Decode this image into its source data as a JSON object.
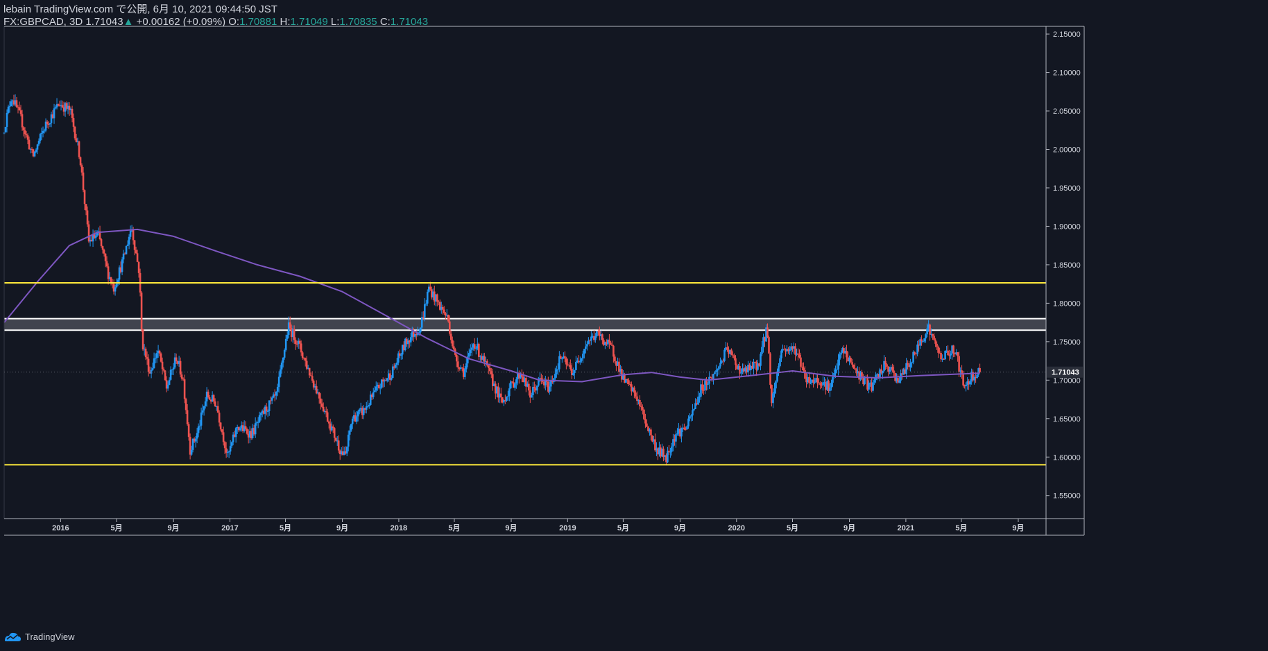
{
  "header": {
    "line1": "lebain TradingView.com で公開, 6月 10, 2021 09:44:50 JST",
    "symbol": "FX:GBPCAD, 3D",
    "last": "1.71043",
    "change": "+0.00162 (+0.09%)",
    "open_label": "O:",
    "open": "1.70881",
    "high_label": "H:",
    "high": "1.71049",
    "low_label": "L:",
    "low": "1.70835",
    "close_label": "C:",
    "close": "1.71043"
  },
  "footer": {
    "brand": "TradingView"
  },
  "colors": {
    "background": "#131722",
    "up": "#2196f3",
    "down": "#ef5350",
    "moving_average": "#7e57c2",
    "horizontal_line": "#ffeb3b",
    "zone_border": "#ffffff",
    "price_label_bg": "#2a2e39"
  },
  "chart_data": {
    "type": "candlestick",
    "ylim": [
      1.52,
      2.16
    ],
    "y_ticks": [
      "1.55000",
      "1.60000",
      "1.65000",
      "1.70000",
      "1.75000",
      "1.80000",
      "1.85000",
      "1.90000",
      "1.95000",
      "2.00000",
      "2.05000",
      "2.10000",
      "2.15000"
    ],
    "x_range": [
      "2015-09-01",
      "2021-10-31"
    ],
    "x_ticks": [
      {
        "label": "2016",
        "date": "2016-01-01"
      },
      {
        "label": "5月",
        "date": "2016-05-01"
      },
      {
        "label": "9月",
        "date": "2016-09-01"
      },
      {
        "label": "2017",
        "date": "2017-01-01"
      },
      {
        "label": "5月",
        "date": "2017-05-01"
      },
      {
        "label": "9月",
        "date": "2017-09-01"
      },
      {
        "label": "2018",
        "date": "2018-01-01"
      },
      {
        "label": "5月",
        "date": "2018-05-01"
      },
      {
        "label": "9月",
        "date": "2018-09-01"
      },
      {
        "label": "2019",
        "date": "2019-01-01"
      },
      {
        "label": "5月",
        "date": "2019-05-01"
      },
      {
        "label": "9月",
        "date": "2019-09-01"
      },
      {
        "label": "2020",
        "date": "2020-01-01"
      },
      {
        "label": "5月",
        "date": "2020-05-01"
      },
      {
        "label": "9月",
        "date": "2020-09-01"
      },
      {
        "label": "2021",
        "date": "2021-01-01"
      },
      {
        "label": "5月",
        "date": "2021-05-01"
      },
      {
        "label": "9月",
        "date": "2021-09-01"
      }
    ],
    "last_price_label": "1.71043",
    "horizontal_lines": [
      1.8265,
      1.59
    ],
    "zone": [
      1.765,
      1.78
    ],
    "price_path": [
      {
        "date": "2015-09-01",
        "price": 2.02
      },
      {
        "date": "2015-09-20",
        "price": 2.07
      },
      {
        "date": "2015-10-10",
        "price": 2.04
      },
      {
        "date": "2015-11-05",
        "price": 1.99
      },
      {
        "date": "2015-12-01",
        "price": 2.03
      },
      {
        "date": "2016-01-01",
        "price": 2.06
      },
      {
        "date": "2016-01-25",
        "price": 2.05
      },
      {
        "date": "2016-02-15",
        "price": 1.99
      },
      {
        "date": "2016-03-05",
        "price": 1.88
      },
      {
        "date": "2016-03-25",
        "price": 1.89
      },
      {
        "date": "2016-04-15",
        "price": 1.84
      },
      {
        "date": "2016-04-28",
        "price": 1.82
      },
      {
        "date": "2016-05-20",
        "price": 1.86
      },
      {
        "date": "2016-06-05",
        "price": 1.9
      },
      {
        "date": "2016-06-22",
        "price": 1.84
      },
      {
        "date": "2016-06-28",
        "price": 1.75
      },
      {
        "date": "2016-07-15",
        "price": 1.71
      },
      {
        "date": "2016-08-01",
        "price": 1.74
      },
      {
        "date": "2016-08-20",
        "price": 1.69
      },
      {
        "date": "2016-09-10",
        "price": 1.73
      },
      {
        "date": "2016-09-25",
        "price": 1.7
      },
      {
        "date": "2016-10-10",
        "price": 1.61
      },
      {
        "date": "2016-10-25",
        "price": 1.63
      },
      {
        "date": "2016-11-15",
        "price": 1.68
      },
      {
        "date": "2016-12-05",
        "price": 1.67
      },
      {
        "date": "2016-12-30",
        "price": 1.6
      },
      {
        "date": "2017-01-20",
        "price": 1.64
      },
      {
        "date": "2017-02-20",
        "price": 1.63
      },
      {
        "date": "2017-03-20",
        "price": 1.66
      },
      {
        "date": "2017-04-15",
        "price": 1.68
      },
      {
        "date": "2017-05-10",
        "price": 1.77
      },
      {
        "date": "2017-05-30",
        "price": 1.75
      },
      {
        "date": "2017-06-25",
        "price": 1.71
      },
      {
        "date": "2017-07-15",
        "price": 1.68
      },
      {
        "date": "2017-08-10",
        "price": 1.64
      },
      {
        "date": "2017-08-30",
        "price": 1.61
      },
      {
        "date": "2017-09-10",
        "price": 1.6
      },
      {
        "date": "2017-09-25",
        "price": 1.65
      },
      {
        "date": "2017-10-20",
        "price": 1.66
      },
      {
        "date": "2017-11-20",
        "price": 1.69
      },
      {
        "date": "2017-12-20",
        "price": 1.71
      },
      {
        "date": "2018-01-20",
        "price": 1.75
      },
      {
        "date": "2018-02-20",
        "price": 1.77
      },
      {
        "date": "2018-03-10",
        "price": 1.82
      },
      {
        "date": "2018-03-30",
        "price": 1.8
      },
      {
        "date": "2018-04-20",
        "price": 1.78
      },
      {
        "date": "2018-05-05",
        "price": 1.73
      },
      {
        "date": "2018-05-25",
        "price": 1.71
      },
      {
        "date": "2018-06-15",
        "price": 1.75
      },
      {
        "date": "2018-07-10",
        "price": 1.72
      },
      {
        "date": "2018-08-15",
        "price": 1.67
      },
      {
        "date": "2018-09-01",
        "price": 1.69
      },
      {
        "date": "2018-09-25",
        "price": 1.71
      },
      {
        "date": "2018-10-15",
        "price": 1.68
      },
      {
        "date": "2018-11-05",
        "price": 1.7
      },
      {
        "date": "2018-11-25",
        "price": 1.69
      },
      {
        "date": "2018-12-20",
        "price": 1.73
      },
      {
        "date": "2019-01-15",
        "price": 1.71
      },
      {
        "date": "2019-02-15",
        "price": 1.75
      },
      {
        "date": "2019-03-10",
        "price": 1.76
      },
      {
        "date": "2019-04-10",
        "price": 1.74
      },
      {
        "date": "2019-05-05",
        "price": 1.7
      },
      {
        "date": "2019-06-01",
        "price": 1.68
      },
      {
        "date": "2019-06-25",
        "price": 1.64
      },
      {
        "date": "2019-07-15",
        "price": 1.61
      },
      {
        "date": "2019-08-05",
        "price": 1.6
      },
      {
        "date": "2019-08-25",
        "price": 1.63
      },
      {
        "date": "2019-09-20",
        "price": 1.64
      },
      {
        "date": "2019-10-20",
        "price": 1.69
      },
      {
        "date": "2019-11-20",
        "price": 1.71
      },
      {
        "date": "2019-12-15",
        "price": 1.74
      },
      {
        "date": "2020-01-15",
        "price": 1.71
      },
      {
        "date": "2020-02-20",
        "price": 1.72
      },
      {
        "date": "2020-03-10",
        "price": 1.77
      },
      {
        "date": "2020-03-20",
        "price": 1.67
      },
      {
        "date": "2020-04-10",
        "price": 1.74
      },
      {
        "date": "2020-05-10",
        "price": 1.74
      },
      {
        "date": "2020-06-05",
        "price": 1.7
      },
      {
        "date": "2020-07-01",
        "price": 1.7
      },
      {
        "date": "2020-07-25",
        "price": 1.69
      },
      {
        "date": "2020-08-20",
        "price": 1.74
      },
      {
        "date": "2020-09-20",
        "price": 1.71
      },
      {
        "date": "2020-10-20",
        "price": 1.69
      },
      {
        "date": "2020-11-20",
        "price": 1.72
      },
      {
        "date": "2020-12-20",
        "price": 1.7
      },
      {
        "date": "2021-01-20",
        "price": 1.73
      },
      {
        "date": "2021-02-20",
        "price": 1.77
      },
      {
        "date": "2021-03-20",
        "price": 1.73
      },
      {
        "date": "2021-04-20",
        "price": 1.74
      },
      {
        "date": "2021-05-10",
        "price": 1.69
      },
      {
        "date": "2021-05-25",
        "price": 1.705
      },
      {
        "date": "2021-06-10",
        "price": 1.7104
      }
    ],
    "moving_average": [
      {
        "date": "2015-09-01",
        "price": 1.775
      },
      {
        "date": "2015-11-15",
        "price": 1.83
      },
      {
        "date": "2016-01-20",
        "price": 1.875
      },
      {
        "date": "2016-03-20",
        "price": 1.892
      },
      {
        "date": "2016-06-15",
        "price": 1.896
      },
      {
        "date": "2016-09-01",
        "price": 1.887
      },
      {
        "date": "2016-12-01",
        "price": 1.868
      },
      {
        "date": "2017-03-01",
        "price": 1.85
      },
      {
        "date": "2017-06-01",
        "price": 1.835
      },
      {
        "date": "2017-09-01",
        "price": 1.815
      },
      {
        "date": "2017-12-01",
        "price": 1.785
      },
      {
        "date": "2018-03-01",
        "price": 1.755
      },
      {
        "date": "2018-06-01",
        "price": 1.728
      },
      {
        "date": "2018-09-01",
        "price": 1.712
      },
      {
        "date": "2018-11-01",
        "price": 1.7
      },
      {
        "date": "2019-02-01",
        "price": 1.698
      },
      {
        "date": "2019-05-01",
        "price": 1.707
      },
      {
        "date": "2019-07-01",
        "price": 1.71
      },
      {
        "date": "2019-09-01",
        "price": 1.704
      },
      {
        "date": "2019-11-01",
        "price": 1.7
      },
      {
        "date": "2020-02-01",
        "price": 1.706
      },
      {
        "date": "2020-05-01",
        "price": 1.712
      },
      {
        "date": "2020-08-01",
        "price": 1.705
      },
      {
        "date": "2020-11-01",
        "price": 1.703
      },
      {
        "date": "2021-02-01",
        "price": 1.706
      },
      {
        "date": "2021-06-10",
        "price": 1.709
      }
    ]
  }
}
